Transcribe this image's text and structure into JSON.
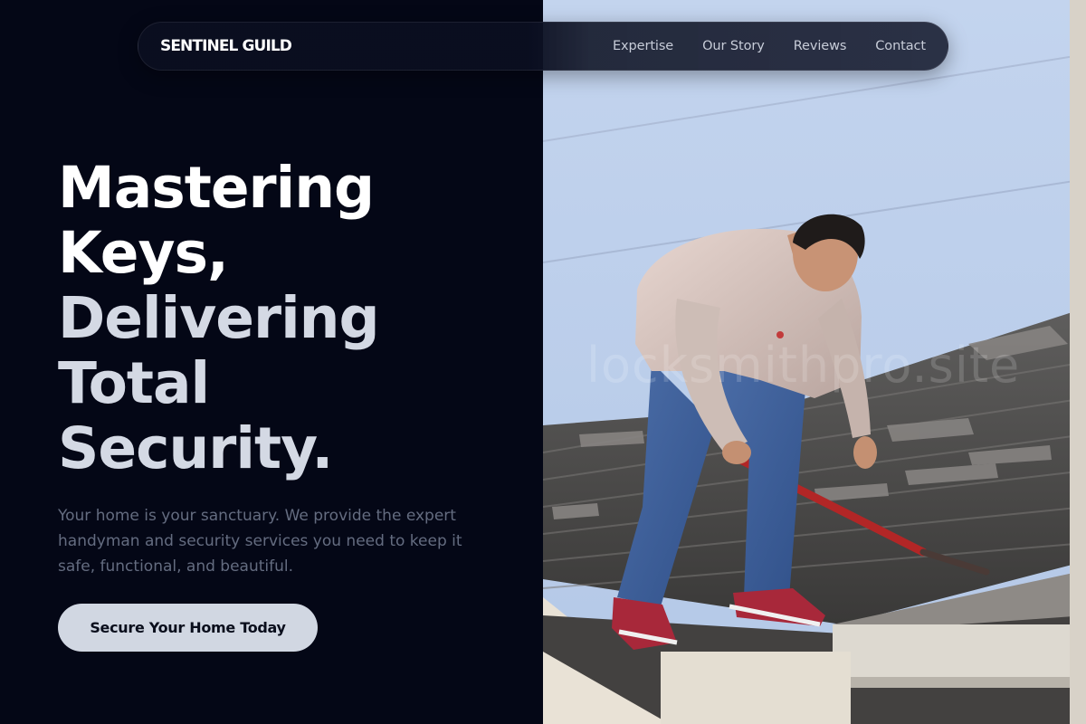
{
  "brand": {
    "name": "SENTINEL GUILD"
  },
  "nav": {
    "links": [
      {
        "label": "Expertise"
      },
      {
        "label": "Our Story"
      },
      {
        "label": "Reviews"
      },
      {
        "label": "Contact"
      }
    ]
  },
  "hero": {
    "headline": {
      "line1": "Mastering",
      "line2": "Keys,",
      "line3": "Delivering",
      "line4": "Total",
      "line5": "Security."
    },
    "subtext": "Your home is your sanctuary. We provide the expert handyman and security services you need to keep it safe, functional, and beautiful.",
    "cta_label": "Secure Your Home Today",
    "image_alt": "Worker on a rooftop removing old shingles",
    "watermark": "locksmithpro.site"
  },
  "colors": {
    "page_background": "#040716",
    "headline_primary": "#ffffff",
    "headline_secondary": "#d4d9e4",
    "body_text": "#646c80",
    "cta_background": "#d1d7e2",
    "cta_text": "#0a0e1c"
  }
}
